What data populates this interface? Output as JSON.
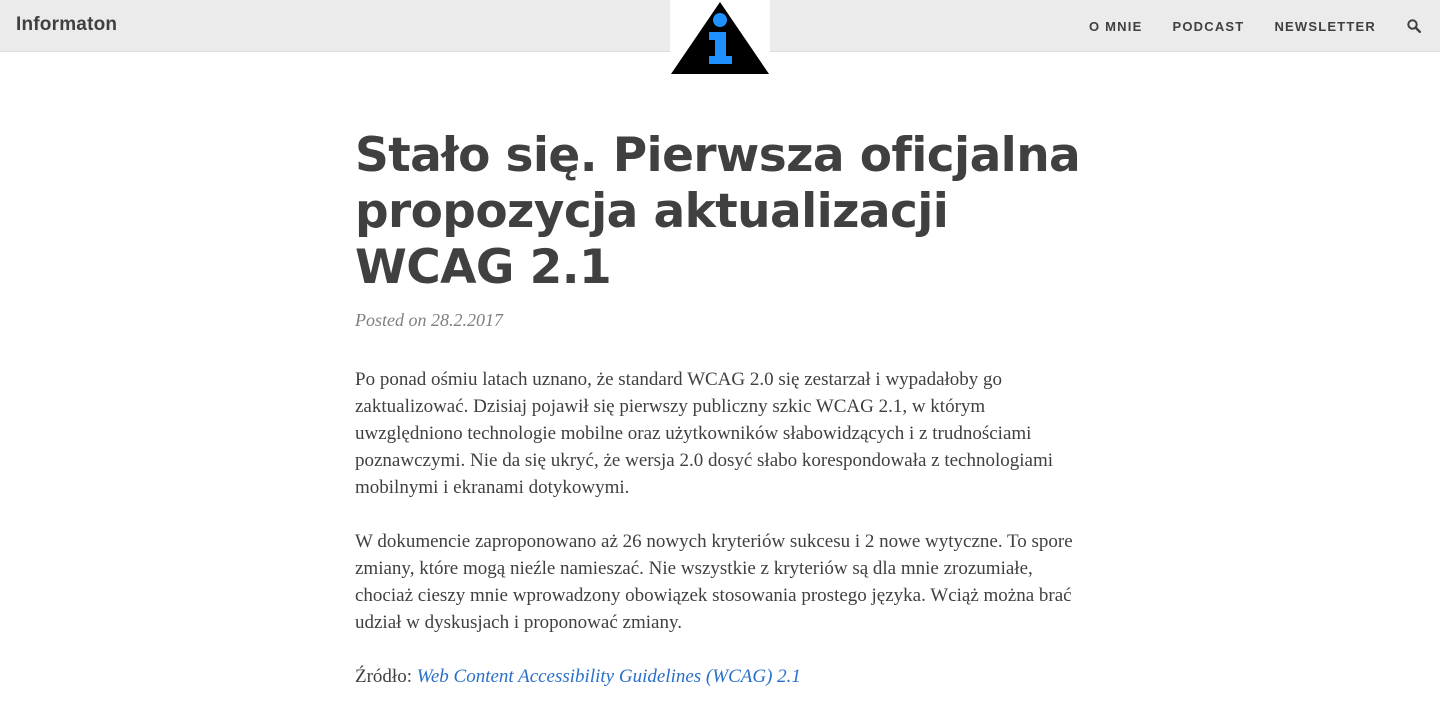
{
  "site": {
    "brand": "Informaton",
    "logo_icon": "info-triangle-icon",
    "logo_colors": {
      "triangle": "#000000",
      "glyph": "#1e90ff"
    }
  },
  "nav": {
    "items": [
      {
        "label": "O MNIE"
      },
      {
        "label": "PODCAST"
      },
      {
        "label": "NEWSLETTER"
      }
    ],
    "search_icon": "search-icon"
  },
  "post": {
    "title": "Stało się. Pierwsza oficjalna propozycja aktualizacji WCAG 2.1",
    "meta": "Posted on 28.2.2017",
    "paragraphs": [
      "Po ponad ośmiu latach uznano, że standard WCAG 2.0 się zestarzał i wypadałoby go zaktualizować. Dzisiaj pojawił się pierwszy publiczny szkic WCAG 2.1, w którym uwzględniono technologie mobilne oraz użytkowników słabowidzących i z trudnościami poznawczymi. Nie da się ukryć, że wersja 2.0 dosyć słabo korespondowała z technologiami mobilnymi i ekranami dotykowymi.",
      "W dokumencie zaproponowano aż 26 nowych kryteriów sukcesu i 2 nowe wytyczne. To spore zmiany, które mogą nieźle namieszać. Nie wszystkie z kryteriów są dla mnie zrozumiałe, chociaż cieszy mnie wprowadzony obowiązek stosowania prostego języka. Wciąż można brać udział w dyskusjach i proponować zmiany."
    ],
    "source_label": "Źródło:",
    "source_link_text": "Web Content Accessibility Guidelines (WCAG) 2.1"
  },
  "colors": {
    "topbar_bg": "#ebebeb",
    "text": "#404040",
    "meta": "#808080",
    "link": "#2a6fc9"
  }
}
